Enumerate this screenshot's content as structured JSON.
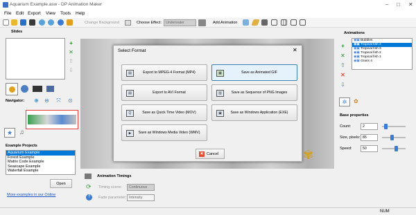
{
  "window": {
    "title": "Aquarium Example.asw - DP Animation Maker"
  },
  "menu": [
    "File",
    "Edit",
    "Export",
    "View",
    "Tools",
    "Help"
  ],
  "toolbar": {
    "change_background": "Change Background",
    "choose_effect_label": "Choose Effect:",
    "effect_value": "Underwater",
    "add_animation": "Add Animation"
  },
  "slides": {
    "title": "Slides"
  },
  "navigator": {
    "title": "Navigator:"
  },
  "example_projects": {
    "title": "Example Projects",
    "items": [
      "Aquarium Example",
      "Forest Example",
      "Matrix Code Example",
      "Seascape Example",
      "Waterfall Example"
    ],
    "selected": 0,
    "open_label": "Open",
    "more_link": "More examples in our Online"
  },
  "animations": {
    "title": "Animations",
    "items": [
      "Bubbles",
      "Tropical fish 4",
      "Tropical fish 3",
      "Tropical fish 2",
      "Tropical fish 1",
      "Grass 4"
    ],
    "selected": 1
  },
  "base_properties": {
    "title": "Base properties",
    "count_label": "Count:",
    "count_value": "2",
    "size_label": "Size, pixels:",
    "size_value": "85",
    "speed_label": "Speed:",
    "speed_value": "50"
  },
  "animation_timings": {
    "title": "Animation Timings",
    "timing_scene_label": "Timing scene:",
    "timing_scene_value": "Continuous",
    "fade_label": "Fade parameter:",
    "fade_value": "Intensity"
  },
  "dialog": {
    "title": "Select Format",
    "buttons": [
      {
        "label": "Export to MPEG-4 Format (MP4)",
        "icon": "film-icon"
      },
      {
        "label": "Save as Animated GIF",
        "icon": "gif-icon"
      },
      {
        "label": "Export to AVI Format",
        "icon": "avi-icon"
      },
      {
        "label": "Save as Sequence of PNG Images",
        "icon": "png-icon"
      },
      {
        "label": "Save as Quick Time Video (MOV)",
        "icon": "quicktime-icon"
      },
      {
        "label": "Save as Windows Application (EXE)",
        "icon": "exe-icon"
      },
      {
        "label": "Save as Windows Media Video (WMV)",
        "icon": "wmv-icon"
      }
    ],
    "selected_index": 1,
    "cancel_label": "Cancel"
  },
  "status": {
    "num": "NUM"
  },
  "colors": {
    "accent": "#3c7fb1",
    "selection": "#0078d7",
    "cancel_icon": "#e84a2f"
  }
}
